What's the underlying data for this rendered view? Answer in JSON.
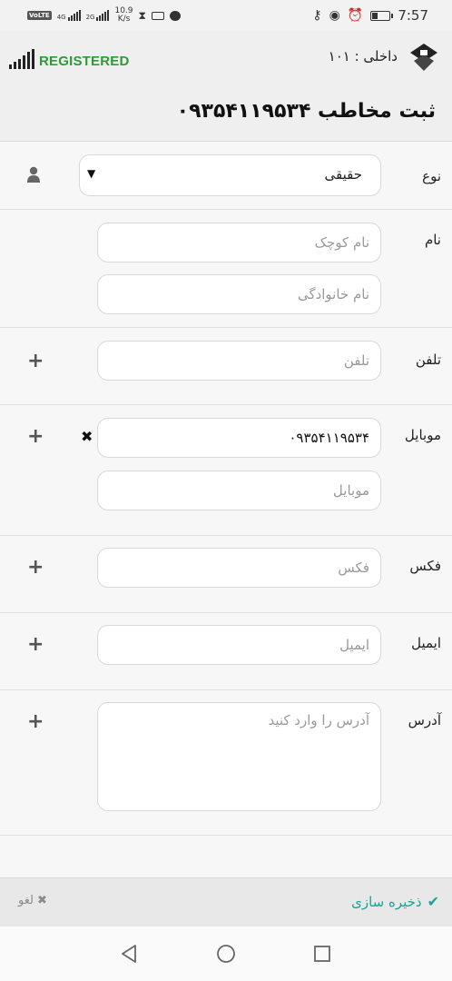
{
  "status_bar": {
    "network_badge": "VoLTE",
    "sig1_label": "4G",
    "sig2_label": "2G",
    "speed_value": "10.9",
    "speed_unit": "K/s",
    "time": "7:57",
    "icons": [
      "hourglass-icon",
      "sim-icon",
      "chat-icon",
      "key-icon",
      "eye-icon",
      "alarm-icon",
      "battery-icon"
    ]
  },
  "header": {
    "registration_status": "REGISTERED",
    "extension": "داخلی : ۱۰۱",
    "title": "ثبت مخاطب ۰۹۳۵۴۱۱۹۵۳۴"
  },
  "form": {
    "type": {
      "label": "نوع",
      "value": "حقیقی"
    },
    "name": {
      "label": "نام",
      "first_placeholder": "نام کوچک",
      "last_placeholder": "نام خانوادگی"
    },
    "phone": {
      "label": "تلفن",
      "placeholder": "تلفن"
    },
    "mobile": {
      "label": "موبایل",
      "value": "۰۹۳۵۴۱۱۹۵۳۴",
      "placeholder": "موبایل"
    },
    "fax": {
      "label": "فکس",
      "placeholder": "فکس"
    },
    "email": {
      "label": "ایمیل",
      "placeholder": "ایمیل"
    },
    "address": {
      "label": "آدرس",
      "placeholder": "آدرس را وارد کنید"
    }
  },
  "actions": {
    "save_label": "ذخیره سازی",
    "cancel_label": "لغو"
  },
  "colors": {
    "accent": "#1aa39a",
    "registered": "#2e9b34"
  }
}
